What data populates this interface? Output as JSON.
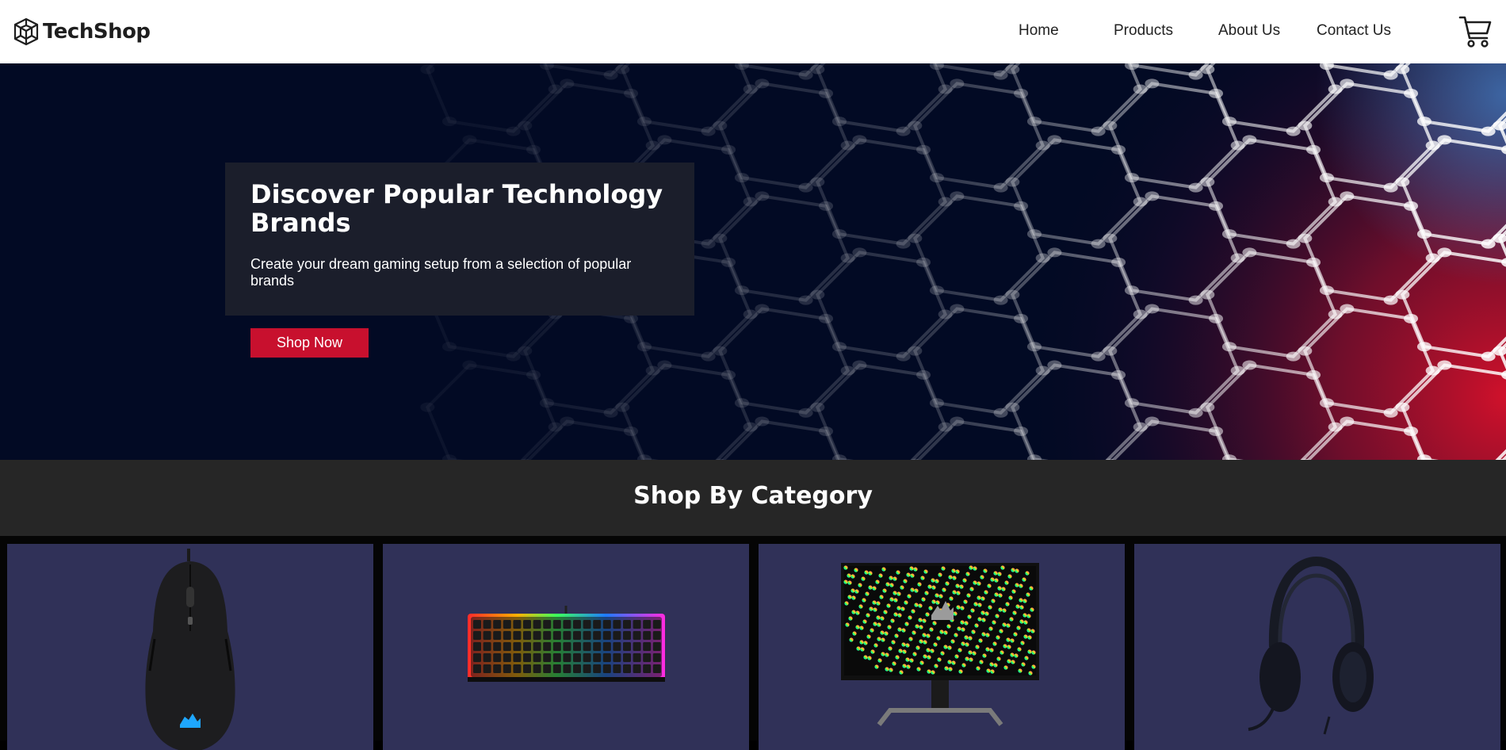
{
  "brand": {
    "name": "TechShop"
  },
  "nav": {
    "items": [
      {
        "label": "Home"
      },
      {
        "label": "Products"
      },
      {
        "label": "About Us"
      },
      {
        "label": "Contact Us"
      }
    ],
    "cart_icon": "shopping-cart-icon"
  },
  "hero": {
    "title": "Discover Popular Technology Brands",
    "subtitle": "Create your dream gaming setup from a selection of popular brands",
    "cta_label": "Shop Now",
    "accent_color": "#c8102e",
    "background_color": "#020a24"
  },
  "category": {
    "title": "Shop By Category",
    "card_color": "#303158",
    "cards": [
      {
        "icon": "mouse-icon"
      },
      {
        "icon": "keyboard-icon"
      },
      {
        "icon": "monitor-icon"
      },
      {
        "icon": "headset-icon"
      }
    ]
  }
}
